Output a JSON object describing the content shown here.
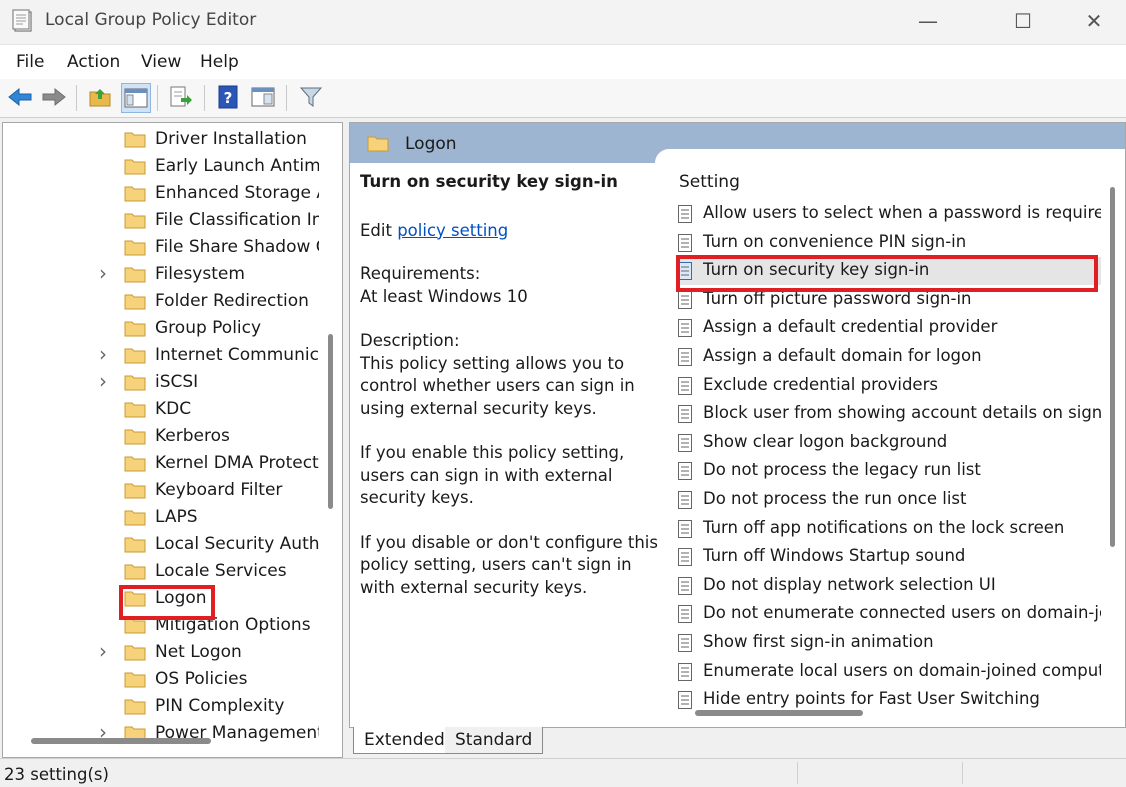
{
  "window": {
    "title": "Local Group Policy Editor",
    "minimize_glyph": "—",
    "maximize_glyph": "☐",
    "close_glyph": "✕"
  },
  "menu": [
    "File",
    "Action",
    "View",
    "Help"
  ],
  "toolbar": [
    "back-arrow-icon",
    "forward-arrow-icon",
    "up-folder-icon",
    "show-hide-tree-icon",
    "export-list-icon",
    "help-icon",
    "properties-icon",
    "filter-icon"
  ],
  "tree": {
    "items": [
      {
        "label": "Driver Installation",
        "expandable": false
      },
      {
        "label": "Early Launch Antimalware",
        "expandable": false
      },
      {
        "label": "Enhanced Storage Access",
        "expandable": false
      },
      {
        "label": "File Classification Infrastructure",
        "expandable": false
      },
      {
        "label": "File Share Shadow Copy",
        "expandable": false
      },
      {
        "label": "Filesystem",
        "expandable": true
      },
      {
        "label": "Folder Redirection",
        "expandable": false
      },
      {
        "label": "Group Policy",
        "expandable": false
      },
      {
        "label": "Internet Communication",
        "expandable": true
      },
      {
        "label": "iSCSI",
        "expandable": true
      },
      {
        "label": "KDC",
        "expandable": false
      },
      {
        "label": "Kerberos",
        "expandable": false
      },
      {
        "label": "Kernel DMA Protection",
        "expandable": false
      },
      {
        "label": "Keyboard Filter",
        "expandable": false
      },
      {
        "label": "LAPS",
        "expandable": false
      },
      {
        "label": "Local Security Authority",
        "expandable": false
      },
      {
        "label": "Locale Services",
        "expandable": false
      },
      {
        "label": "Logon",
        "expandable": false,
        "selected": true
      },
      {
        "label": "Mitigation Options",
        "expandable": false
      },
      {
        "label": "Net Logon",
        "expandable": true
      },
      {
        "label": "OS Policies",
        "expandable": false
      },
      {
        "label": "PIN Complexity",
        "expandable": false
      },
      {
        "label": "Power Management",
        "expandable": true
      }
    ]
  },
  "right": {
    "header": "Logon",
    "description": {
      "title": "Turn on security key sign-in",
      "edit_prefix": "Edit ",
      "edit_link": "policy setting ",
      "req_label": "Requirements:",
      "req_value": "At least Windows 10",
      "desc_label": "Description:",
      "p1": "This policy setting allows you to control whether users can sign in using external security keys.",
      "p2": "If you enable this policy setting, users can sign in with external security keys.",
      "p3": "If you disable or don't configure this policy setting, users can't sign in with external security keys."
    },
    "column_header": "Setting",
    "settings": [
      "Allow users to select when a password is required when resuming from connected standby",
      "Turn on convenience PIN sign-in",
      "Turn on security key sign-in",
      "Turn off picture password sign-in",
      "Assign a default credential provider",
      "Assign a default domain for logon",
      "Exclude credential providers",
      "Block user from showing account details on sign-in",
      "Show clear logon background",
      "Do not process the legacy run list",
      "Do not process the run once list",
      "Turn off app notifications on the lock screen",
      "Turn off Windows Startup sound",
      "Do not display network selection UI",
      "Do not enumerate connected users on domain-joined computers",
      "Show first sign-in animation",
      "Enumerate local users on domain-joined computers",
      "Hide entry points for Fast User Switching"
    ],
    "selected_setting_index": 2
  },
  "tabs": [
    "Extended",
    "Standard"
  ],
  "status": "23 setting(s)",
  "colors": {
    "highlight": "#e01f24",
    "header_band": "#9db5d1",
    "link": "#0050c0"
  }
}
